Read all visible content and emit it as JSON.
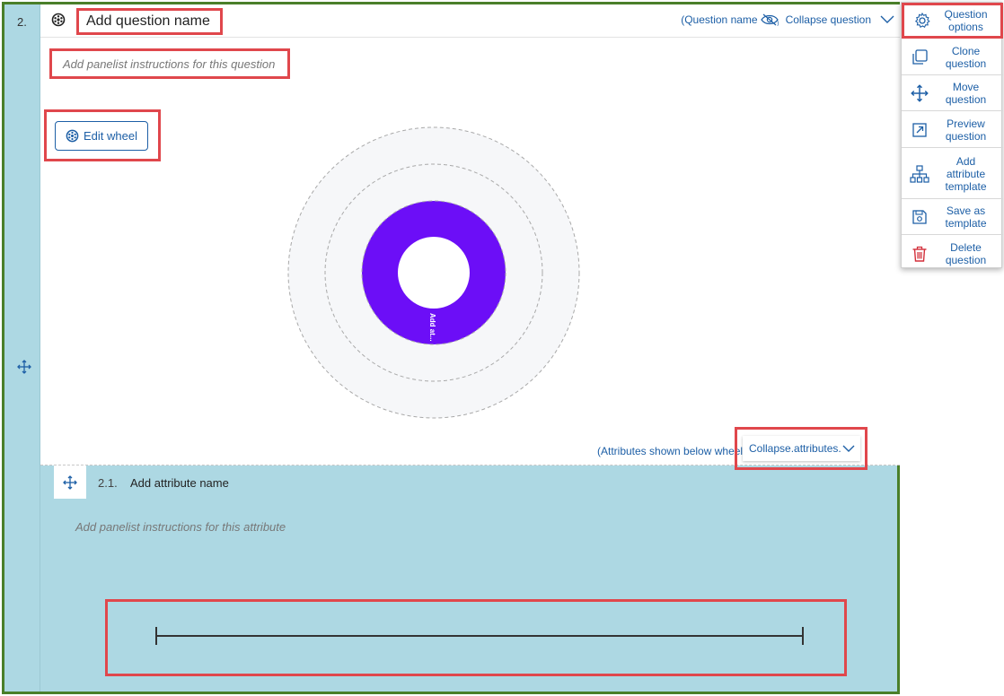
{
  "question": {
    "number": "2.",
    "name": "Add question name",
    "instructions_placeholder": "Add panelist instructions for this question",
    "name_toggle_label": "(Question name",
    "collapse_label": "Collapse question",
    "edit_wheel_label": "Edit wheel",
    "wheel_segment_label": "Add at...",
    "attributes_shown_label": "(Attributes shown below wheel",
    "collapse_attributes_label": "Collapse.attributes."
  },
  "attribute": {
    "number": "2.1.",
    "name": "Add attribute name",
    "instructions_placeholder": "Add panelist instructions for this attribute"
  },
  "menu": {
    "items": [
      {
        "label": "Question options",
        "icon": "gear-icon"
      },
      {
        "label": "Clone question",
        "icon": "clone-icon"
      },
      {
        "label": "Move question",
        "icon": "move-icon"
      },
      {
        "label": "Preview question",
        "icon": "external-link-icon"
      },
      {
        "label": "Add attribute template",
        "icon": "hierarchy-icon"
      },
      {
        "label": "Save as template",
        "icon": "save-icon"
      },
      {
        "label": "Delete question",
        "icon": "trash-icon"
      }
    ]
  },
  "colors": {
    "accent": "#1d5fa6",
    "wheel_fill": "#6c0ef7",
    "panel_bg": "#add8e3",
    "highlight": "#e0474c",
    "frame": "#4a7f2a",
    "delete": "#d32f3a"
  }
}
